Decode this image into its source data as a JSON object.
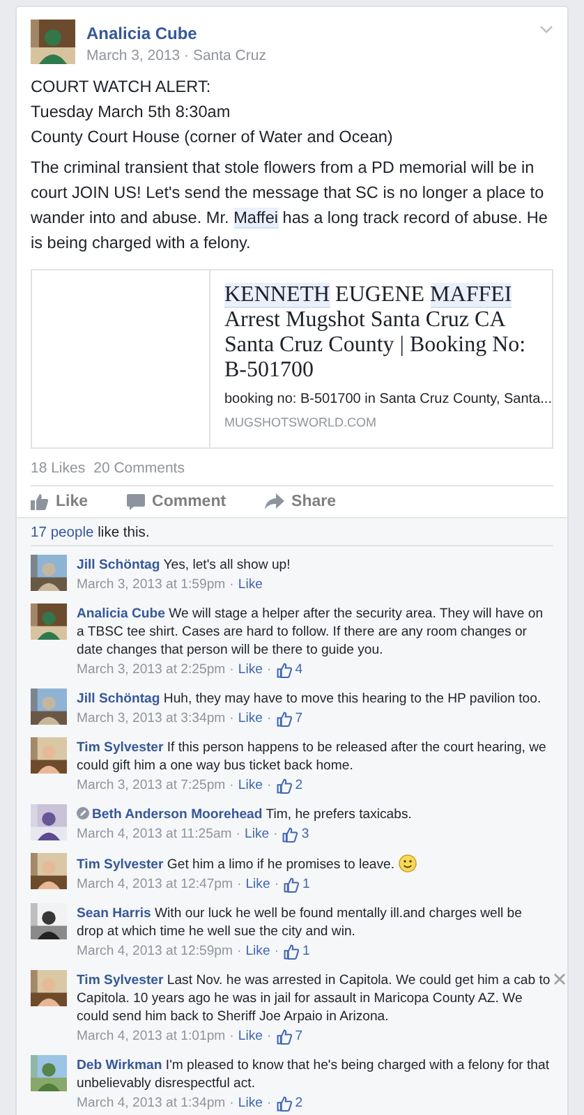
{
  "post": {
    "author": "Analicia Cube",
    "meta": "March 3, 2013 · Santa Cruz",
    "lines": [
      "COURT WATCH ALERT:",
      "Tuesday March 5th 8:30am",
      "County Court House (corner of Water and Ocean)"
    ],
    "body": [
      {
        "text": "The criminal transient that stole flowers from a PD memorial will be in court JOIN US! Let's send the message that SC is no longer a place to wander into and abuse. Mr. ",
        "highlighted": false
      },
      {
        "text": "Maffei",
        "highlighted": true
      },
      {
        "text": " has a long track record of abuse. He is being charged with a felony.",
        "highlighted": false
      }
    ],
    "link": {
      "title": [
        {
          "text": "KENNETH",
          "highlighted": true
        },
        {
          "text": " EUGENE ",
          "highlighted": false
        },
        {
          "text": "MAFFEI",
          "highlighted": true
        },
        {
          "text": " Arrest Mugshot Santa Cruz CA Santa Cruz County | Booking No: B-501700",
          "highlighted": false
        }
      ],
      "description": "booking no: B-501700 in Santa Cruz County, Santa...",
      "domain": "MUGSHOTSWORLD.COM"
    },
    "stats": {
      "likes": "18 Likes",
      "comments": "20 Comments"
    },
    "actions": [
      {
        "kind": "like",
        "label": "Like"
      },
      {
        "kind": "comment",
        "label": "Comment"
      },
      {
        "kind": "share",
        "label": "Share"
      }
    ]
  },
  "likes_summary": {
    "people": "17 people",
    "rest": "like this."
  },
  "comments": [
    {
      "author": "Jill Schöntag",
      "text": "Yes, let's all show up!",
      "time": "March 3, 2013 at 1:59pm",
      "separators": [
        "·"
      ],
      "like": "Like",
      "edited": false,
      "smiley": false,
      "close": false
    },
    {
      "author": "Analicia Cube",
      "text": "We will stage a helper after the security area. They will have on a TBSC tee shirt. Cases are hard to follow. If there are any room changes or date changes that person will be there to guide you.",
      "time": "March 3, 2013 at 2:25pm",
      "separators": [
        "·",
        "·"
      ],
      "like": "Like",
      "count": "4",
      "edited": false,
      "smiley": false,
      "close": false
    },
    {
      "author": "Jill Schöntag",
      "text": "Huh, they may have to move this hearing to the HP pavilion too.",
      "time": "March 3, 2013 at 3:34pm",
      "separators": [
        "·",
        "·"
      ],
      "like": "Like",
      "count": "7",
      "edited": false,
      "smiley": false,
      "close": false
    },
    {
      "author": "Tim Sylvester",
      "text": "If this person happens to be released after the court hearing, we could gift him a one way bus ticket back home.",
      "time": "March 3, 2013 at 7:25pm",
      "separators": [
        "·",
        "·"
      ],
      "like": "Like",
      "count": "2",
      "edited": false,
      "smiley": false,
      "close": false
    },
    {
      "author": "Beth Anderson Moorehead",
      "text": "Tim, he prefers taxicabs.",
      "time": "March 4, 2013 at 11:25am",
      "separators": [
        "·",
        "·"
      ],
      "like": "Like",
      "count": "3",
      "edited": true,
      "smiley": false,
      "close": false
    },
    {
      "author": "Tim Sylvester",
      "text": "Get him a limo if he promises to leave.",
      "time": "March 4, 2013 at 12:47pm",
      "separators": [
        "·",
        "·"
      ],
      "like": "Like",
      "count": "1",
      "edited": false,
      "smiley": true,
      "close": false
    },
    {
      "author": "Sean Harris",
      "text": "With our luck he well be found mentally ill.and charges well be drop at which time he well sue the city and win.",
      "time": "March 4, 2013 at 12:59pm",
      "separators": [
        "·",
        "·"
      ],
      "like": "Like",
      "count": "1",
      "edited": false,
      "smiley": false,
      "close": false
    },
    {
      "author": "Tim Sylvester",
      "text": "Last Nov. he was arrested in Capitola. We could get him a cab to Capitola. 10 years ago he was in jail for assault in Maricopa County AZ. We could send him back to Sheriff Joe Arpaio in Arizona.",
      "time": "March 4, 2013 at 1:01pm",
      "separators": [
        "·",
        "·"
      ],
      "like": "Like",
      "count": "7",
      "edited": false,
      "smiley": false,
      "close": true
    },
    {
      "author": "Deb Wirkman",
      "text": "I'm pleased to know that he's being charged with a felony for that unbelievably disrespectful act.",
      "time": "March 4, 2013 at 1:34pm",
      "separators": [
        "·",
        "·"
      ],
      "like": "Like",
      "count": "2",
      "edited": false,
      "smiley": false,
      "close": false
    }
  ]
}
